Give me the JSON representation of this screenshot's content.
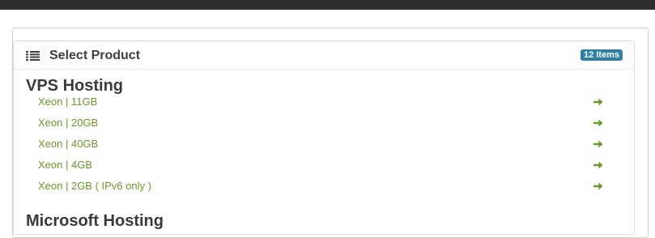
{
  "panel": {
    "title": "Select Product",
    "badge": "12 Items"
  },
  "groups": [
    {
      "name": "VPS Hosting",
      "products": [
        {
          "label": "Xeon | 11GB"
        },
        {
          "label": "Xeon | 20GB"
        },
        {
          "label": "Xeon | 40GB"
        },
        {
          "label": "Xeon | 4GB"
        },
        {
          "label": "Xeon | 2GB ( IPv6 only )"
        }
      ]
    },
    {
      "name": "Microsoft Hosting",
      "products": []
    }
  ],
  "colors": {
    "link": "#6a9a2a",
    "badge": "#2f7fa8",
    "topbar": "#2d2d2d"
  },
  "icons": {
    "heading": "list-icon",
    "row": "arrow-right-icon"
  }
}
